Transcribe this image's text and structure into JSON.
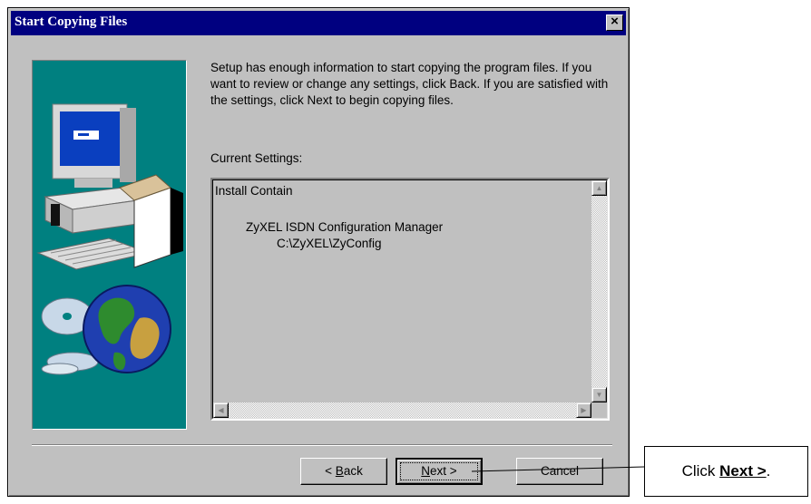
{
  "dialog": {
    "title": "Start Copying Files",
    "close_glyph": "×",
    "intro": "Setup has enough information to start copying the program files. If you want to review or change any settings, click Back.  If you are satisfied with the settings, click Next to begin copying files.",
    "current_settings_label": "Current Settings:",
    "settings_lines": [
      "Install Contain",
      "ZyXEL ISDN Configuration Manager",
      "C:\\ZyXEL\\ZyConfig"
    ],
    "buttons": {
      "back": {
        "prefix": "< ",
        "mnemonic": "B",
        "rest": "ack"
      },
      "next": {
        "mnemonic": "N",
        "rest": "ext >"
      },
      "cancel": "Cancel"
    }
  },
  "callout": {
    "prefix": "Click ",
    "bold": "Next >",
    "suffix": "."
  },
  "colors": {
    "titlebar": "#000080",
    "face": "#c0c0c0",
    "art_bg": "#008080"
  }
}
